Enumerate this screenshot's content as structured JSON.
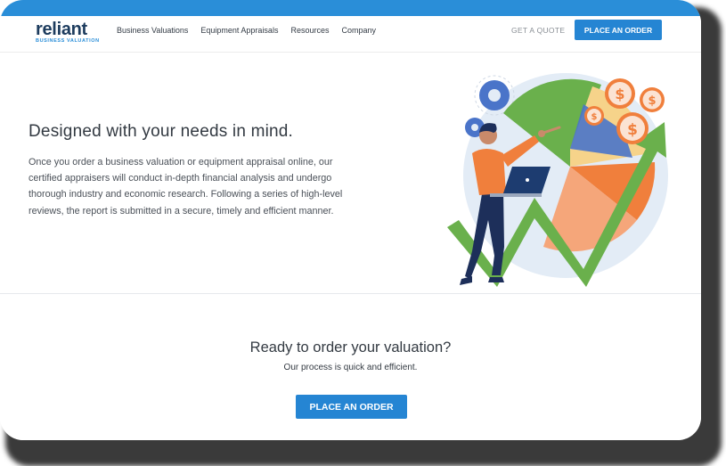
{
  "brand": {
    "name": "reliant",
    "tagline": "BUSINESS VALUATION"
  },
  "nav": {
    "items": [
      {
        "label": "Business Valuations"
      },
      {
        "label": "Equipment Appraisals"
      },
      {
        "label": "Resources"
      },
      {
        "label": "Company"
      }
    ],
    "quote_label": "GET A QUOTE",
    "order_label": "PLACE AN ORDER"
  },
  "hero": {
    "title": "Designed with your needs in mind.",
    "body": "Once you order a business valuation or equipment appraisal online, our certified appraisers will conduct in-depth financial analysis and undergo thorough industry and economic research. Following a series of high-level reviews, the report is submitted in a secure, timely and efficient manner.",
    "illustration": {
      "coin_symbol": "$",
      "icons": [
        "gear-icon",
        "coin-icon",
        "growth-arrow-icon",
        "pie-chart-icon",
        "laptop-icon"
      ]
    }
  },
  "cta": {
    "title": "Ready to order your valuation?",
    "subtitle": "Our process is quick and efficient.",
    "button_label": "PLACE AN ORDER"
  },
  "colors": {
    "accent": "#2585d3",
    "brand_dark": "#1d3c5e",
    "green": "#6ab04c",
    "orange": "#f07f3c"
  }
}
